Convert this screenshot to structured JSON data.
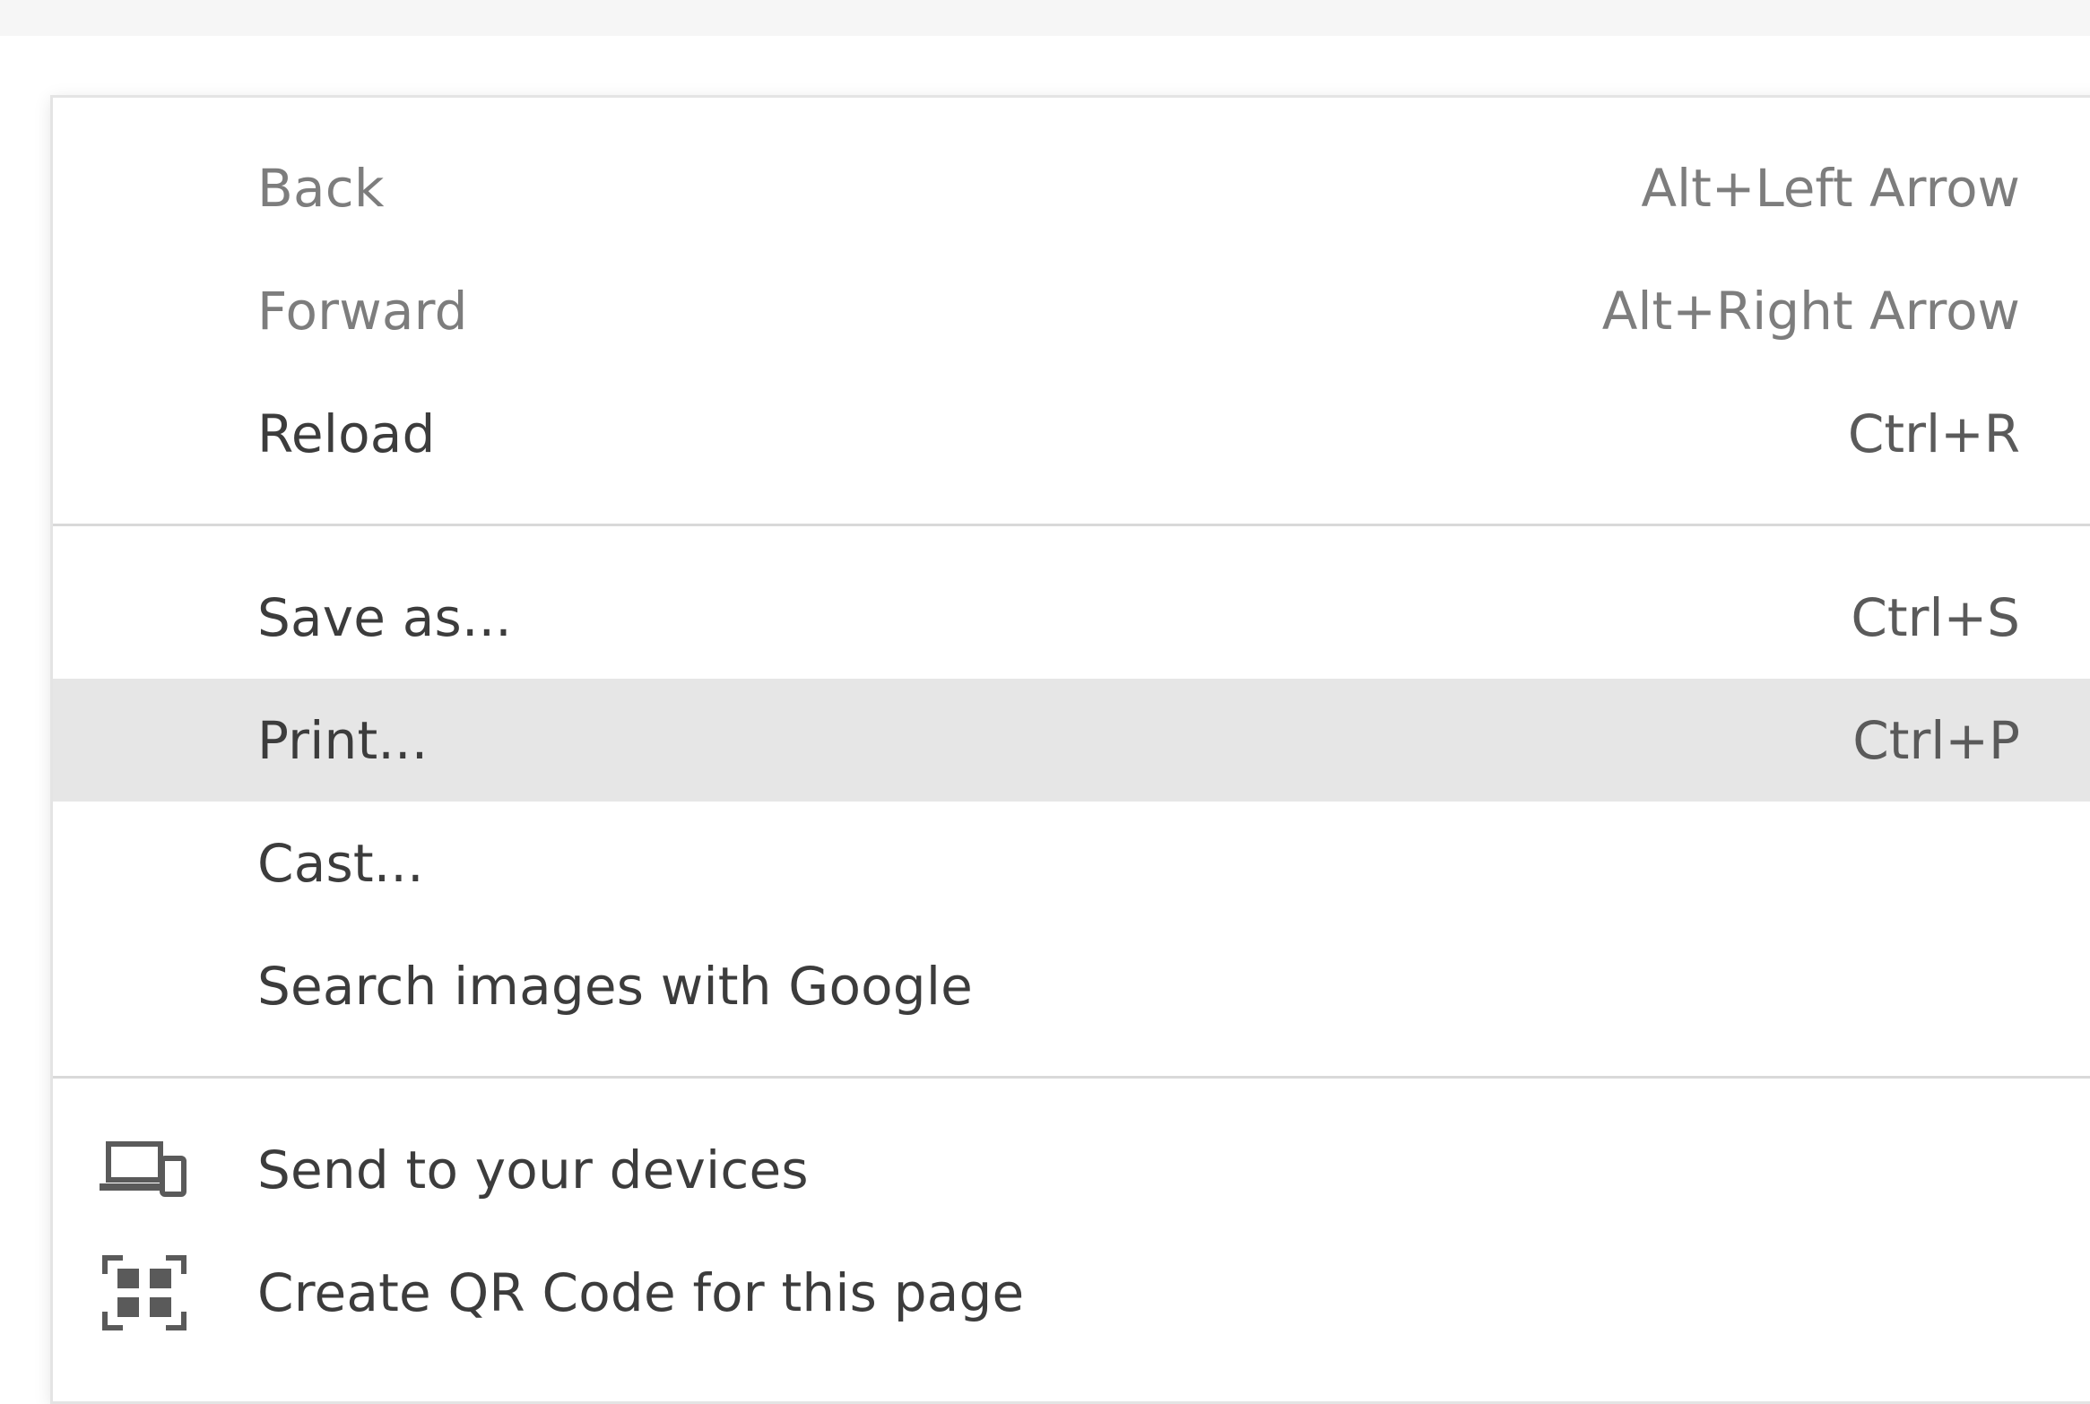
{
  "menu": {
    "group1": [
      {
        "label": "Back",
        "shortcut": "Alt+Left Arrow"
      },
      {
        "label": "Forward",
        "shortcut": "Alt+Right Arrow"
      },
      {
        "label": "Reload",
        "shortcut": "Ctrl+R"
      }
    ],
    "group2": [
      {
        "label": "Save as...",
        "shortcut": "Ctrl+S"
      },
      {
        "label": "Print...",
        "shortcut": "Ctrl+P",
        "highlighted": true
      },
      {
        "label": "Cast...",
        "shortcut": ""
      },
      {
        "label": "Search images with Google",
        "shortcut": ""
      }
    ],
    "group3": [
      {
        "label": "Send to your devices",
        "icon": "devices-icon"
      },
      {
        "label": "Create QR Code for this page",
        "icon": "qr-code-icon"
      }
    ]
  },
  "colors": {
    "highlight": "#e6e6e6",
    "separator": "#d9d9d9",
    "text": "#3c3c3c",
    "disabled_text": "#7d7d7d"
  }
}
